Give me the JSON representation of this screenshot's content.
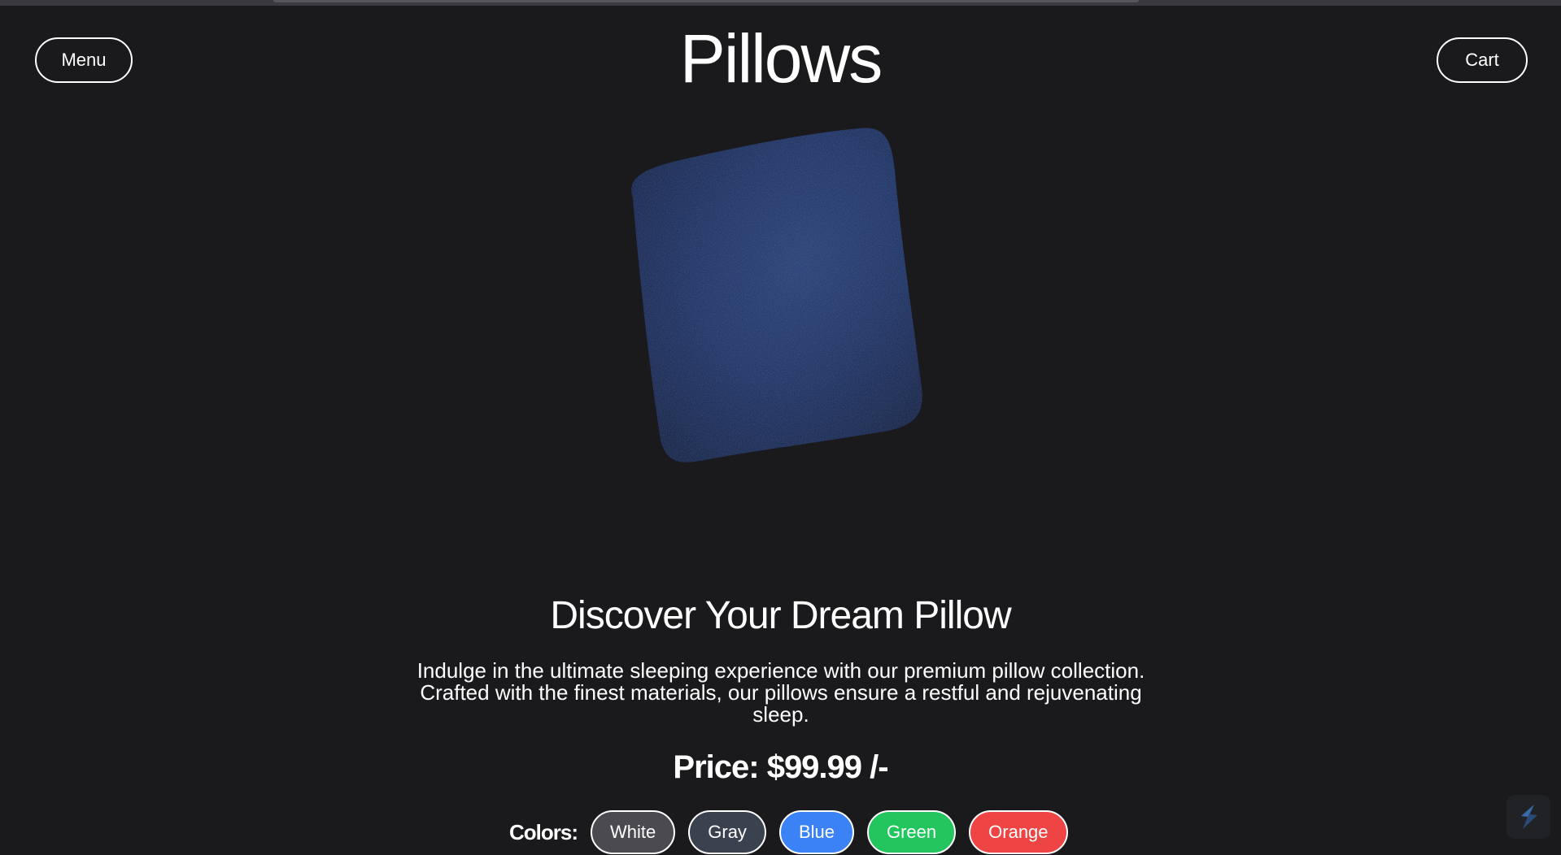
{
  "header": {
    "menu_label": "Menu",
    "title": "Pillows",
    "cart_label": "Cart"
  },
  "hero": {
    "product_color": "#142654"
  },
  "content": {
    "heading": "Discover Your Dream Pillow",
    "description": "Indulge in the ultimate sleeping experience with our premium pillow collection. Crafted with the finest materials, our pillows ensure a restful and rejuvenating sleep.",
    "price": "Price: $99.99 /-"
  },
  "colors": {
    "label": "Colors:",
    "options": [
      {
        "label": "White",
        "color": "#4a4a50"
      },
      {
        "label": "Gray",
        "color": "#3a414f"
      },
      {
        "label": "Blue",
        "color": "#3b82f6"
      },
      {
        "label": "Green",
        "color": "#22c55e"
      },
      {
        "label": "Orange",
        "color": "#ef4444"
      }
    ]
  },
  "theme": {
    "background": "#1a1a1d",
    "text": "#ffffff"
  }
}
